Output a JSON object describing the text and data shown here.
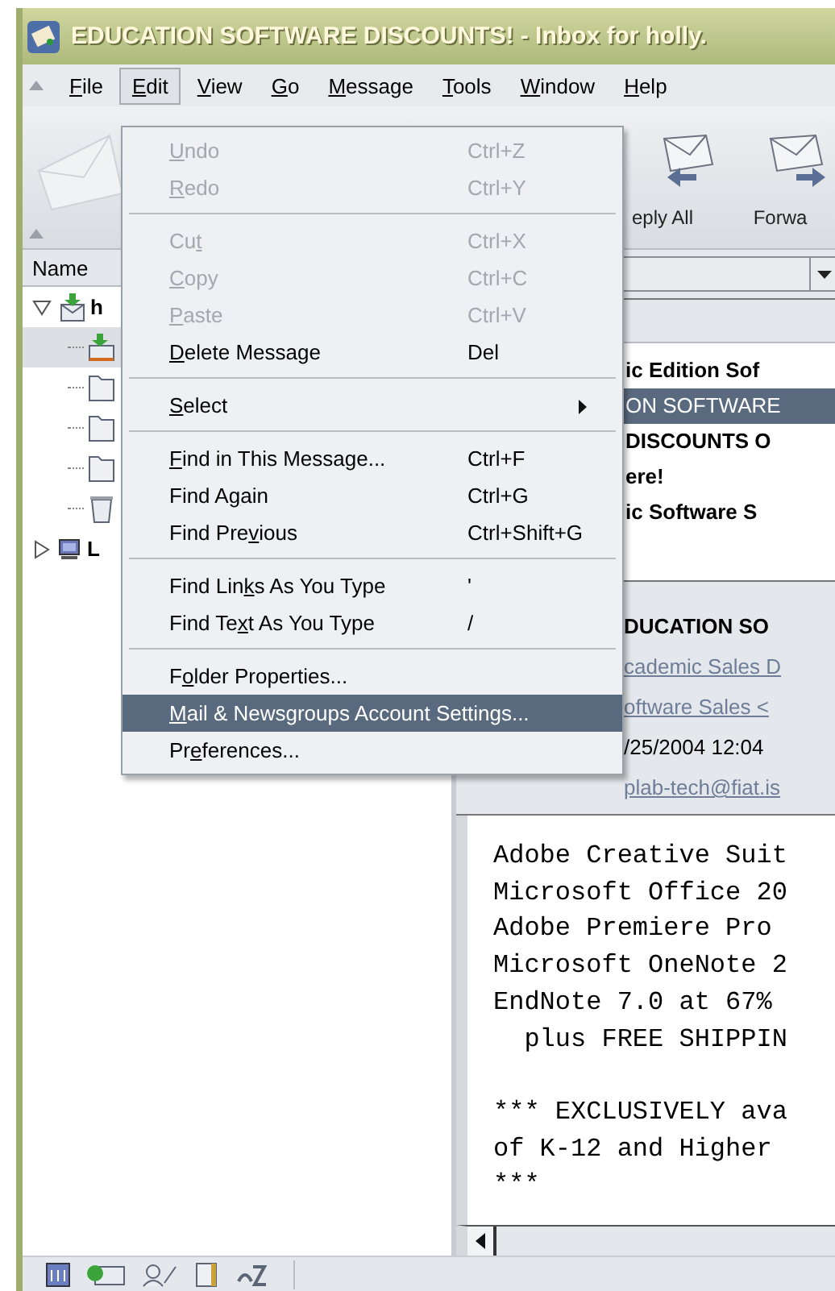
{
  "window": {
    "title": "EDUCATION SOFTWARE DISCOUNTS! - Inbox for holly."
  },
  "menubar": {
    "items": [
      {
        "key": "F",
        "post": "ile",
        "selected": false
      },
      {
        "key": "E",
        "post": "dit",
        "selected": true
      },
      {
        "key": "V",
        "post": "iew",
        "selected": false
      },
      {
        "key": "G",
        "post": "o",
        "selected": false
      },
      {
        "key": "M",
        "post": "essage",
        "selected": false
      },
      {
        "key": "T",
        "post": "ools",
        "selected": false
      },
      {
        "key": "W",
        "post": "indow",
        "selected": false
      },
      {
        "key": "H",
        "post": "elp",
        "selected": false
      }
    ]
  },
  "toolbar": {
    "buttons": [
      {
        "kind": "reply-all",
        "label": "eply All"
      },
      {
        "kind": "forward",
        "label": "Forwa"
      }
    ]
  },
  "folder_pane": {
    "column": "Name",
    "tree": [
      {
        "kind": "account",
        "label": "h",
        "expanded": true,
        "selected": false,
        "children": [
          {
            "kind": "inbox",
            "selected": true
          },
          {
            "kind": "folder",
            "selected": false
          },
          {
            "kind": "folder",
            "selected": false
          },
          {
            "kind": "folder",
            "selected": false
          },
          {
            "kind": "trash",
            "selected": false
          }
        ]
      },
      {
        "kind": "computer",
        "label": "L",
        "expanded": false,
        "selected": false
      }
    ]
  },
  "message_list": {
    "rows": [
      {
        "text": "ic Edition Sof",
        "unread": true,
        "selected": false
      },
      {
        "text": "ON SOFTWARE",
        "unread": false,
        "selected": true
      },
      {
        "text": "DISCOUNTS O",
        "unread": true,
        "selected": false
      },
      {
        "text": "ere!",
        "unread": true,
        "selected": false
      },
      {
        "text": "ic Software S",
        "unread": true,
        "selected": false
      }
    ]
  },
  "message_header": {
    "fields": [
      {
        "kind": "subject",
        "text": "DUCATION SO"
      },
      {
        "kind": "link",
        "text": "cademic Sales D"
      },
      {
        "kind": "link",
        "text": "oftware Sales <"
      },
      {
        "kind": "plain",
        "text": "/25/2004 12:04"
      },
      {
        "kind": "link",
        "text": "plab-tech@fiat.is"
      }
    ]
  },
  "message_body": {
    "paragraphs": [
      {
        "lines": [
          "Adobe Creative Suit",
          "Microsoft Office 20",
          "Adobe Premiere Pro",
          "Microsoft OneNote 2",
          "EndNote 7.0 at 67%",
          "  plus FREE SHIPPIN"
        ]
      },
      {
        "lines": [
          "*** EXCLUSIVELY ava",
          "of K-12 and Higher",
          "***"
        ]
      }
    ]
  },
  "edit_menu": {
    "items": [
      {
        "kind": "item",
        "key": "U",
        "post": "ndo",
        "shortcut": "Ctrl+Z",
        "disabled": true,
        "selected": false
      },
      {
        "kind": "item",
        "key": "R",
        "post": "edo",
        "shortcut": "Ctrl+Y",
        "disabled": true,
        "selected": false
      },
      {
        "kind": "separator"
      },
      {
        "kind": "item",
        "pre": "Cu",
        "key": "t",
        "shortcut": "Ctrl+X",
        "disabled": true,
        "selected": false
      },
      {
        "kind": "item",
        "key": "C",
        "post": "opy",
        "shortcut": "Ctrl+C",
        "disabled": true,
        "selected": false
      },
      {
        "kind": "item",
        "key": "P",
        "post": "aste",
        "shortcut": "Ctrl+V",
        "disabled": true,
        "selected": false
      },
      {
        "kind": "item",
        "key": "D",
        "post": "elete Message",
        "shortcut": "Del",
        "disabled": false,
        "selected": false
      },
      {
        "kind": "separator"
      },
      {
        "kind": "submenu",
        "key": "S",
        "post": "elect",
        "disabled": false,
        "selected": false
      },
      {
        "kind": "separator"
      },
      {
        "kind": "item",
        "key": "F",
        "post": "ind in This Message...",
        "shortcut": "Ctrl+F",
        "disabled": false,
        "selected": false
      },
      {
        "kind": "item",
        "pre": "Find A",
        "key": "g",
        "post": "ain",
        "shortcut": "Ctrl+G",
        "disabled": false,
        "selected": false
      },
      {
        "kind": "item",
        "pre": "Find Pre",
        "key": "v",
        "post": "ious",
        "shortcut": "Ctrl+Shift+G",
        "disabled": false,
        "selected": false
      },
      {
        "kind": "separator"
      },
      {
        "kind": "item",
        "pre": "Find Lin",
        "key": "k",
        "post": "s As You Type",
        "shortcut": "'",
        "disabled": false,
        "selected": false
      },
      {
        "kind": "item",
        "pre": "Find Te",
        "key": "x",
        "post": "t As You Type",
        "shortcut": "/",
        "disabled": false,
        "selected": false
      },
      {
        "kind": "separator"
      },
      {
        "kind": "item",
        "pre": "F",
        "key": "o",
        "post": "lder Properties...",
        "disabled": false,
        "selected": false
      },
      {
        "kind": "item",
        "key": "M",
        "post": "ail & Newsgroups Account Settings...",
        "disabled": false,
        "selected": true
      },
      {
        "kind": "item",
        "pre": "Pr",
        "key": "e",
        "post": "ferences...",
        "disabled": false,
        "selected": false
      }
    ]
  }
}
